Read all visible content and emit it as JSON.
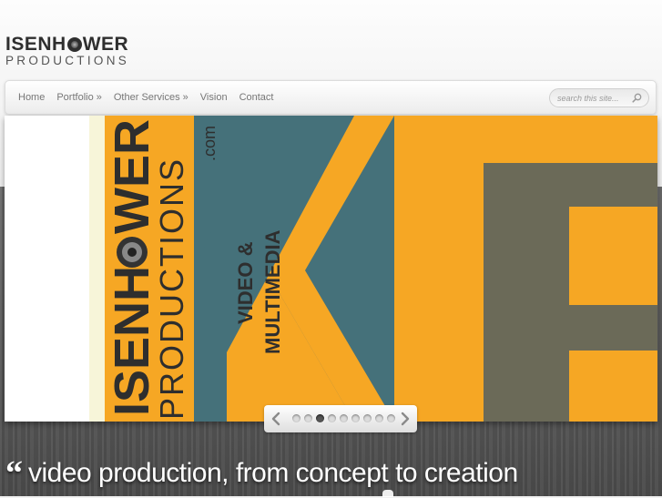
{
  "header": {
    "logo": {
      "line1_left": "ISENH",
      "line1_right": "WER",
      "line2": "PRODUCTIONS"
    }
  },
  "nav": {
    "items": [
      {
        "label": "Home"
      },
      {
        "label": "Portfolio »"
      },
      {
        "label": "Other Services »"
      },
      {
        "label": "Vision"
      },
      {
        "label": "Contact"
      }
    ],
    "search": {
      "placeholder": "search this site...",
      "icon": "search-icon"
    }
  },
  "slider": {
    "artwork": {
      "brand_left": "ISENH",
      "brand_right": "WER",
      "brand_sub": "PRODUCTIONS",
      "domain": ".com",
      "line1": "VIDEO &",
      "line2": "MULTIMEDIA"
    },
    "controls": {
      "prev_icon": "chevron-left-icon",
      "next_icon": "chevron-right-icon",
      "dot_count": 9,
      "active_index": 2
    },
    "colors": {
      "orange": "#f6a724",
      "teal": "#45717a",
      "olive": "#6b6a58"
    }
  },
  "tagline": {
    "quote_mark": "“",
    "text": "video production, from concept to creation"
  }
}
